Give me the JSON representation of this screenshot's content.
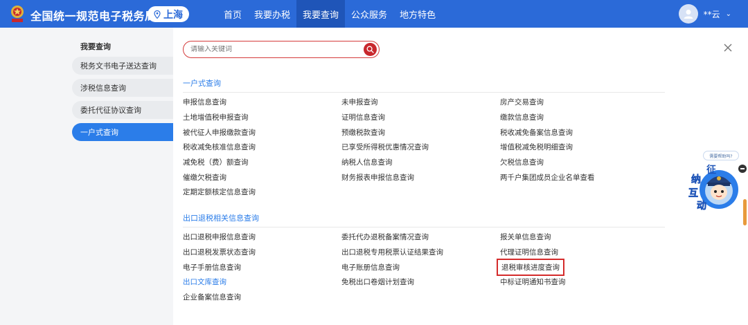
{
  "header": {
    "brand": "全国统一规范电子税务局",
    "region": "上海",
    "nav": [
      {
        "label": "首页"
      },
      {
        "label": "我要办税"
      },
      {
        "label": "我要查询"
      },
      {
        "label": "公众服务"
      },
      {
        "label": "地方特色"
      }
    ],
    "active_nav_index": 2,
    "user_name": "**云",
    "accent": "#2b6ad8"
  },
  "sidebar": {
    "title": "我要查询",
    "items": [
      {
        "label": "税务文书电子送达查询"
      },
      {
        "label": "涉税信息查询"
      },
      {
        "label": "委托代征协议查询"
      },
      {
        "label": "一户式查询"
      }
    ],
    "active_index": 3
  },
  "search": {
    "placeholder": "请输入关键词",
    "value": ""
  },
  "sections": [
    {
      "title": "一户式查询",
      "items": [
        "申报信息查询",
        "未申报查询",
        "房产交易查询",
        "土地增值税申报查询",
        "证明信息查询",
        "缴款信息查询",
        "被代征人申报缴款查询",
        "预缴税款查询",
        "税收减免备案信息查询",
        "税收减免核准信息查询",
        "已享受所得税优惠情况查询",
        "增值税减免税明细查询",
        "减免税（费）额查询",
        "纳税人信息查询",
        "欠税信息查询",
        "催缴欠税查询",
        "财务报表申报信息查询",
        "两千户集团成员企业名单查看",
        "定期定额核定信息查询"
      ]
    },
    {
      "title": "出口退税相关信息查询",
      "items": [
        "出口退税申报信息查询",
        "委托代办退税备案情况查询",
        "报关单信息查询",
        "出口退税发票状态查询",
        "出口退税专用税票认证结果查询",
        "代理证明信息查询",
        "电子手册信息查询",
        "电子账册信息查询",
        "退税审核进度查询",
        "出口文库查询",
        "免税出口卷烟计划查询",
        "中标证明通知书查询",
        "企业备案信息查询"
      ],
      "highlighted_item": "退税审核进度查询",
      "blue_item": "出口文库查询"
    }
  ],
  "assistant": {
    "bubble": "需要帮助吗?",
    "chars": [
      "征",
      "纳",
      "互",
      "动"
    ]
  }
}
